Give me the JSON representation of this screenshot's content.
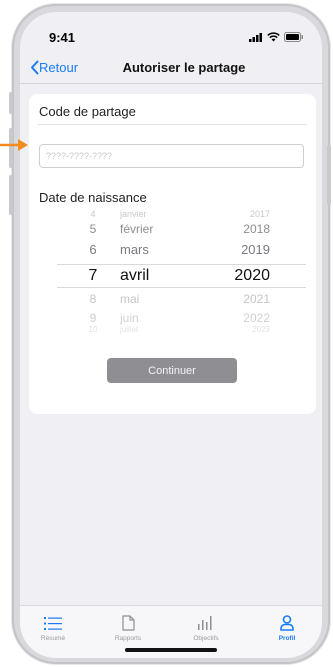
{
  "status_bar": {
    "time": "9:41"
  },
  "nav": {
    "back_label": "Retour",
    "title": "Autoriser le partage"
  },
  "form": {
    "code_label": "Code de partage",
    "code_placeholder": "????-????-????",
    "code_value": "",
    "birthdate_label": "Date de naissance"
  },
  "picker": {
    "rows": [
      {
        "day": "4",
        "month": "janvier",
        "year": "2017"
      },
      {
        "day": "5",
        "month": "février",
        "year": "2018"
      },
      {
        "day": "6",
        "month": "mars",
        "year": "2019"
      },
      {
        "day": "7",
        "month": "avril",
        "year": "2020"
      },
      {
        "day": "8",
        "month": "mai",
        "year": "2021"
      },
      {
        "day": "9",
        "month": "juin",
        "year": "2022"
      },
      {
        "day": "10",
        "month": "juillet",
        "year": "2023"
      }
    ],
    "selected": {
      "day": "7",
      "month": "avril",
      "year": "2020"
    }
  },
  "continue_label": "Continuer",
  "tabs": [
    {
      "label": "Résumé",
      "icon": "list-icon"
    },
    {
      "label": "Rapports",
      "icon": "document-icon"
    },
    {
      "label": "Objectifs",
      "icon": "chart-icon"
    },
    {
      "label": "Profil",
      "icon": "person-icon",
      "active": true
    }
  ],
  "colors": {
    "accent": "#1a7cf5",
    "arrow": "#f28c1e",
    "button": "#8e8e93"
  }
}
